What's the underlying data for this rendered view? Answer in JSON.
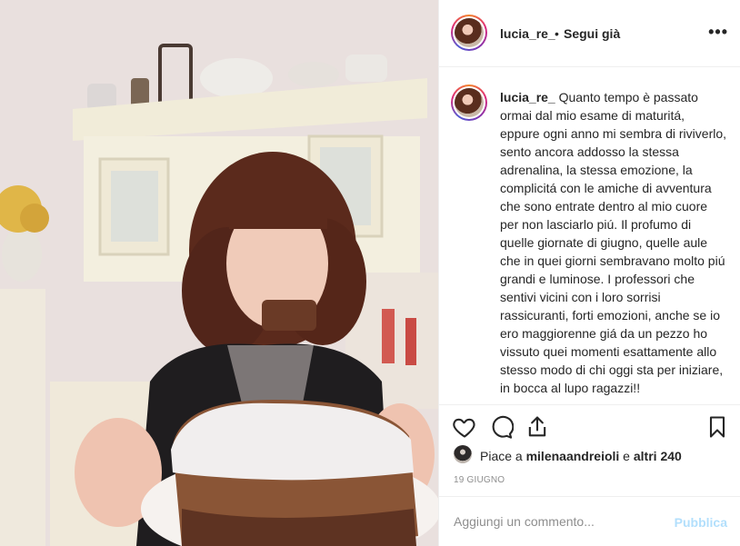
{
  "post": {
    "photo_alt": "Foto del post"
  },
  "header": {
    "username": "lucia_re_",
    "separator": "•",
    "follow_status": "Segui già",
    "more_icon": "•••"
  },
  "caption": {
    "username": "lucia_re_",
    "text": "Quanto tempo è passato ormai dal mio esame di maturitá, eppure ogni anno mi sembra di riviverlo, sento ancora addosso la stessa adrenalina, la stessa emozione, la complicitá con le amiche di avventura che sono entrate dentro al mio cuore per non lasciarlo piú. Il profumo di quelle giornate di giugno, quelle aule che in quei giorni sembravano molto piú grandi e luminose. I professori che sentivi vicini con i loro sorrisi rassicuranti, forti emozioni, anche se io ero maggiorenne giá da un pezzo ho vissuto quei momenti esattamente allo stesso modo di chi oggi sta per iniziare, in bocca al lupo ragazzi!!"
  },
  "actions": {
    "icons": [
      "heart-icon",
      "comment-icon",
      "share-icon",
      "bookmark-icon"
    ]
  },
  "likes": {
    "prefix": "Piace a ",
    "user": "milenaandreioli",
    "middle": " e ",
    "others": "altri 240"
  },
  "date": "19 GIUGNO",
  "comment": {
    "placeholder": "Aggiungi un commento...",
    "publish_label": "Pubblica"
  },
  "colors": {
    "text": "#262626",
    "muted": "#8e8e8e",
    "publish_disabled": "#b2dffc",
    "divider": "#efefef"
  }
}
